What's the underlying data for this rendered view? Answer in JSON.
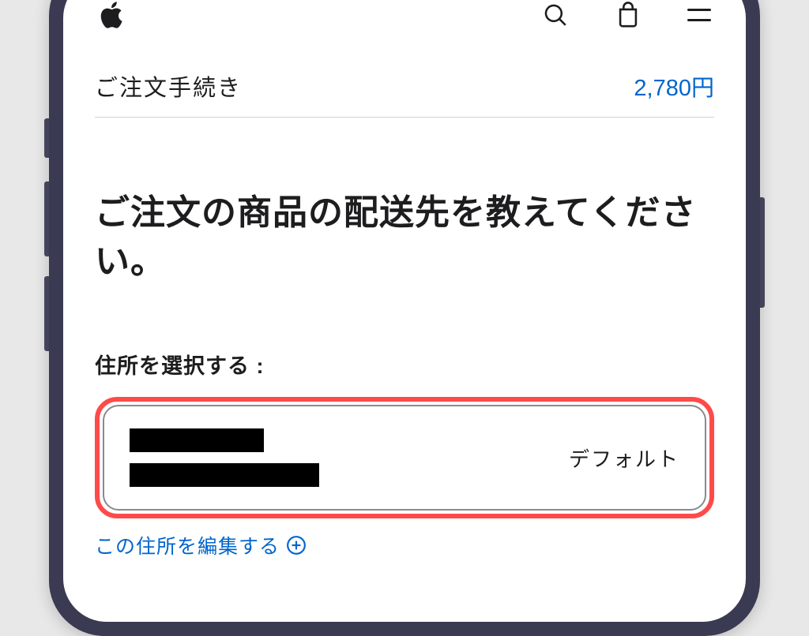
{
  "header": {
    "logo": "apple-logo",
    "icons": [
      "search",
      "bag",
      "menu"
    ]
  },
  "checkout": {
    "label": "ご注文手続き",
    "price": "2,780円"
  },
  "main": {
    "heading": "ご注文の商品の配送先を教えてください。",
    "address_select_label": "住所を選択する :",
    "address_card": {
      "default_label": "デフォルト"
    },
    "edit_link": "この住所を編集する"
  },
  "colors": {
    "link": "#0066cc",
    "highlight": "#ff4a4a",
    "text": "#1d1d1f"
  }
}
